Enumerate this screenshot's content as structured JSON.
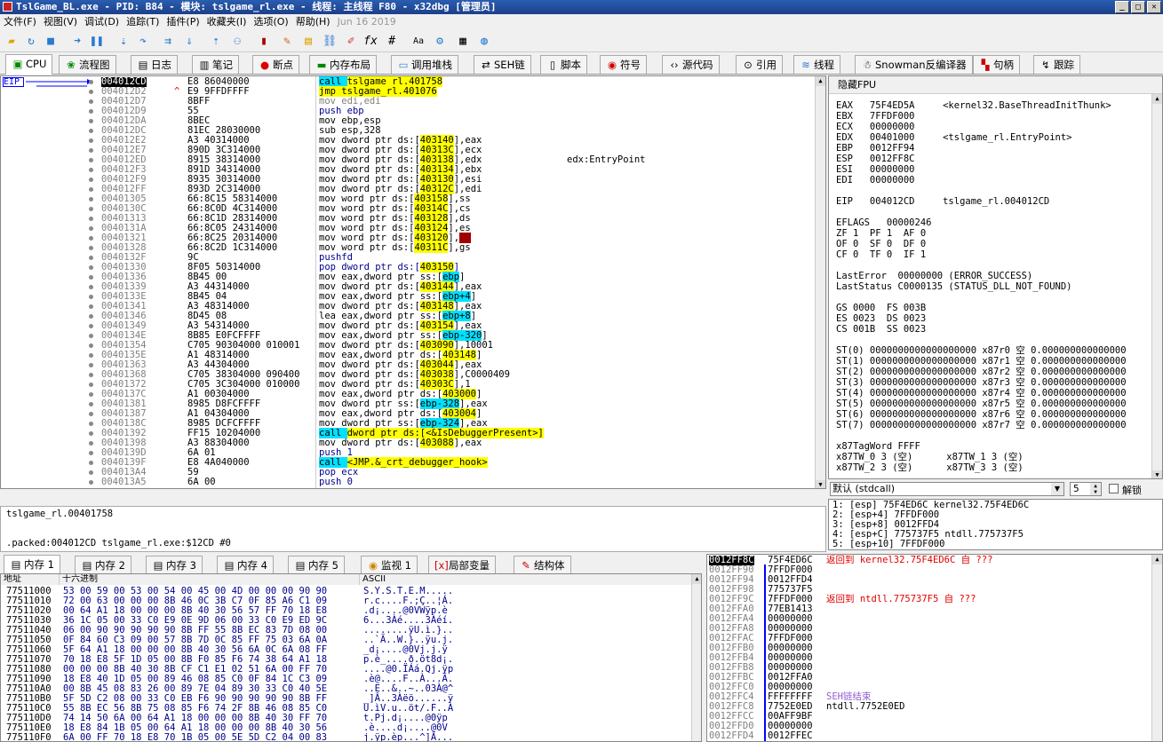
{
  "window": {
    "title": "TslGame_BL.exe - PID: B84 - 模块: tslgame_rl.exe - 线程: 主线程 F80 - x32dbg [管理员]",
    "date": "Jun 16 2019"
  },
  "menu": [
    "文件(F)",
    "视图(V)",
    "调试(D)",
    "追踪(T)",
    "插件(P)",
    "收藏夹(I)",
    "选项(O)",
    "帮助(H)"
  ],
  "tabs": [
    {
      "label": "CPU",
      "icon": "cpu-icon"
    },
    {
      "label": "流程图",
      "icon": "graph-icon"
    },
    {
      "label": "日志",
      "icon": "log-icon"
    },
    {
      "label": "笔记",
      "icon": "notes-icon"
    },
    {
      "label": "断点",
      "icon": "breakpoint-icon"
    },
    {
      "label": "内存布局",
      "icon": "memory-map-icon"
    },
    {
      "label": "调用堆栈",
      "icon": "call-stack-icon"
    },
    {
      "label": "SEH链",
      "icon": "seh-icon"
    },
    {
      "label": "脚本",
      "icon": "script-icon"
    },
    {
      "label": "符号",
      "icon": "symbol-icon"
    },
    {
      "label": "源代码",
      "icon": "source-icon"
    },
    {
      "label": "引用",
      "icon": "reference-icon"
    },
    {
      "label": "线程",
      "icon": "thread-icon"
    },
    {
      "label": "Snowman反编译器",
      "icon": "snowman-icon"
    },
    {
      "label": "句柄",
      "icon": "handle-icon"
    },
    {
      "label": "跟踪",
      "icon": "trace-icon"
    }
  ],
  "eip_label": "EIP",
  "disasm": [
    {
      "a": "004012CD",
      "b": "E8 86040000",
      "d": [
        [
          "c",
          "call "
        ],
        [
          "y",
          "tslgame_rl.401758"
        ]
      ],
      "cm": ""
    },
    {
      "a": "004012D2",
      "b": "E9 9FFDFFFF",
      "d": [
        [
          "y",
          "jmp "
        ],
        [
          "y",
          "tslgame_rl.401076"
        ]
      ],
      "cm": ""
    },
    {
      "a": "004012D7",
      "b": "8BFF",
      "d": [
        [
          "g",
          "mov edi,edi"
        ]
      ],
      "cm": ""
    },
    {
      "a": "004012D9",
      "b": "55",
      "d": [
        [
          "k",
          "push ebp"
        ]
      ],
      "cm": ""
    },
    {
      "a": "004012DA",
      "b": "8BEC",
      "d": [
        [
          "n",
          "mov ebp,esp"
        ]
      ],
      "cm": ""
    },
    {
      "a": "004012DC",
      "b": "81EC 28030000",
      "d": [
        [
          "n",
          "sub esp,328"
        ]
      ],
      "cm": ""
    },
    {
      "a": "004012E2",
      "b": "A3 40314000",
      "d": [
        [
          "n",
          "mov dword ptr ds:["
        ],
        [
          "y",
          "403140"
        ],
        [
          "n",
          "],eax"
        ]
      ],
      "cm": ""
    },
    {
      "a": "004012E7",
      "b": "890D 3C314000",
      "d": [
        [
          "n",
          "mov dword ptr ds:["
        ],
        [
          "y",
          "40313C"
        ],
        [
          "n",
          "],ecx"
        ]
      ],
      "cm": ""
    },
    {
      "a": "004012ED",
      "b": "8915 38314000",
      "d": [
        [
          "n",
          "mov dword ptr ds:["
        ],
        [
          "y",
          "403138"
        ],
        [
          "n",
          "],edx"
        ]
      ],
      "cm": "edx:EntryPoint"
    },
    {
      "a": "004012F3",
      "b": "891D 34314000",
      "d": [
        [
          "n",
          "mov dword ptr ds:["
        ],
        [
          "y",
          "403134"
        ],
        [
          "n",
          "],ebx"
        ]
      ],
      "cm": ""
    },
    {
      "a": "004012F9",
      "b": "8935 30314000",
      "d": [
        [
          "n",
          "mov dword ptr ds:["
        ],
        [
          "y",
          "403130"
        ],
        [
          "n",
          "],esi"
        ]
      ],
      "cm": ""
    },
    {
      "a": "004012FF",
      "b": "893D 2C314000",
      "d": [
        [
          "n",
          "mov dword ptr ds:["
        ],
        [
          "y",
          "40312C"
        ],
        [
          "n",
          "],edi"
        ]
      ],
      "cm": ""
    },
    {
      "a": "00401305",
      "b": "66:8C15 58314000",
      "d": [
        [
          "n",
          "mov word ptr ds:["
        ],
        [
          "y",
          "403158"
        ],
        [
          "n",
          "],ss"
        ]
      ],
      "cm": ""
    },
    {
      "a": "0040130C",
      "b": "66:8C0D 4C314000",
      "d": [
        [
          "n",
          "mov word ptr ds:["
        ],
        [
          "y",
          "40314C"
        ],
        [
          "n",
          "],cs"
        ]
      ],
      "cm": ""
    },
    {
      "a": "00401313",
      "b": "66:8C1D 28314000",
      "d": [
        [
          "n",
          "mov word ptr ds:["
        ],
        [
          "y",
          "403128"
        ],
        [
          "n",
          "],ds"
        ]
      ],
      "cm": ""
    },
    {
      "a": "0040131A",
      "b": "66:8C05 24314000",
      "d": [
        [
          "n",
          "mov word ptr ds:["
        ],
        [
          "y",
          "403124"
        ],
        [
          "n",
          "],es"
        ]
      ],
      "cm": ""
    },
    {
      "a": "00401321",
      "b": "66:8C25 20314000",
      "d": [
        [
          "n",
          "mov word ptr ds:["
        ],
        [
          "y",
          "403120"
        ],
        [
          "n",
          "],"
        ],
        [
          "r",
          "fs"
        ]
      ],
      "cm": ""
    },
    {
      "a": "00401328",
      "b": "66:8C2D 1C314000",
      "d": [
        [
          "n",
          "mov word ptr ds:["
        ],
        [
          "y",
          "40311C"
        ],
        [
          "n",
          "],gs"
        ]
      ],
      "cm": ""
    },
    {
      "a": "0040132F",
      "b": "9C",
      "d": [
        [
          "k",
          "pushfd"
        ]
      ],
      "cm": ""
    },
    {
      "a": "00401330",
      "b": "8F05 50314000",
      "d": [
        [
          "k",
          "pop dword ptr ds:["
        ],
        [
          "y",
          "403150"
        ],
        [
          "k",
          "]"
        ]
      ],
      "cm": ""
    },
    {
      "a": "00401336",
      "b": "8B45 00",
      "d": [
        [
          "n",
          "mov eax,dword ptr ss:["
        ],
        [
          "c",
          "ebp"
        ],
        [
          "n",
          "]"
        ]
      ],
      "cm": ""
    },
    {
      "a": "00401339",
      "b": "A3 44314000",
      "d": [
        [
          "n",
          "mov dword ptr ds:["
        ],
        [
          "y",
          "403144"
        ],
        [
          "n",
          "],eax"
        ]
      ],
      "cm": ""
    },
    {
      "a": "0040133E",
      "b": "8B45 04",
      "d": [
        [
          "n",
          "mov eax,dword ptr ss:["
        ],
        [
          "c",
          "ebp+4"
        ],
        [
          "n",
          "]"
        ]
      ],
      "cm": ""
    },
    {
      "a": "00401341",
      "b": "A3 48314000",
      "d": [
        [
          "n",
          "mov dword ptr ds:["
        ],
        [
          "y",
          "403148"
        ],
        [
          "n",
          "],eax"
        ]
      ],
      "cm": ""
    },
    {
      "a": "00401346",
      "b": "8D45 08",
      "d": [
        [
          "n",
          "lea eax,dword ptr ss:["
        ],
        [
          "c",
          "ebp+8"
        ],
        [
          "n",
          "]"
        ]
      ],
      "cm": ""
    },
    {
      "a": "00401349",
      "b": "A3 54314000",
      "d": [
        [
          "n",
          "mov dword ptr ds:["
        ],
        [
          "y",
          "403154"
        ],
        [
          "n",
          "],eax"
        ]
      ],
      "cm": ""
    },
    {
      "a": "0040134E",
      "b": "8B85 E0FCFFFF",
      "d": [
        [
          "n",
          "mov eax,dword ptr ss:["
        ],
        [
          "c",
          "ebp-320"
        ],
        [
          "n",
          "]"
        ]
      ],
      "cm": ""
    },
    {
      "a": "00401354",
      "b": "C705 90304000 010001",
      "d": [
        [
          "n",
          "mov dword ptr ds:["
        ],
        [
          "y",
          "403090"
        ],
        [
          "n",
          "],10001"
        ]
      ],
      "cm": ""
    },
    {
      "a": "0040135E",
      "b": "A1 48314000",
      "d": [
        [
          "n",
          "mov eax,dword ptr ds:["
        ],
        [
          "y",
          "403148"
        ],
        [
          "n",
          "]"
        ]
      ],
      "cm": ""
    },
    {
      "a": "00401363",
      "b": "A3 44304000",
      "d": [
        [
          "n",
          "mov dword ptr ds:["
        ],
        [
          "y",
          "403044"
        ],
        [
          "n",
          "],eax"
        ]
      ],
      "cm": ""
    },
    {
      "a": "00401368",
      "b": "C705 38304000 090400",
      "d": [
        [
          "n",
          "mov dword ptr ds:["
        ],
        [
          "y",
          "403038"
        ],
        [
          "n",
          "],C0000409"
        ]
      ],
      "cm": ""
    },
    {
      "a": "00401372",
      "b": "C705 3C304000 010000",
      "d": [
        [
          "n",
          "mov dword ptr ds:["
        ],
        [
          "y",
          "40303C"
        ],
        [
          "n",
          "],1"
        ]
      ],
      "cm": ""
    },
    {
      "a": "0040137C",
      "b": "A1 00304000",
      "d": [
        [
          "n",
          "mov eax,dword ptr ds:["
        ],
        [
          "y",
          "403000"
        ],
        [
          "n",
          "]"
        ]
      ],
      "cm": ""
    },
    {
      "a": "00401381",
      "b": "8985 D8FCFFFF",
      "d": [
        [
          "n",
          "mov dword ptr ss:["
        ],
        [
          "c",
          "ebp-328"
        ],
        [
          "n",
          "],eax"
        ]
      ],
      "cm": ""
    },
    {
      "a": "00401387",
      "b": "A1 04304000",
      "d": [
        [
          "n",
          "mov eax,dword ptr ds:["
        ],
        [
          "y",
          "403004"
        ],
        [
          "n",
          "]"
        ]
      ],
      "cm": ""
    },
    {
      "a": "0040138C",
      "b": "8985 DCFCFFFF",
      "d": [
        [
          "n",
          "mov dword ptr ss:["
        ],
        [
          "c",
          "ebp-324"
        ],
        [
          "n",
          "],eax"
        ]
      ],
      "cm": ""
    },
    {
      "a": "00401392",
      "b": "FF15 10204000",
      "d": [
        [
          "c",
          "call "
        ],
        [
          "y",
          "dword ptr ds:[<&IsDebuggerPresent>]"
        ]
      ],
      "cm": ""
    },
    {
      "a": "00401398",
      "b": "A3 88304000",
      "d": [
        [
          "n",
          "mov dword ptr ds:["
        ],
        [
          "y",
          "403088"
        ],
        [
          "n",
          "],eax"
        ]
      ],
      "cm": ""
    },
    {
      "a": "0040139D",
      "b": "6A 01",
      "d": [
        [
          "k",
          "push 1"
        ]
      ],
      "cm": ""
    },
    {
      "a": "0040139F",
      "b": "E8 4A040000",
      "d": [
        [
          "c",
          "call "
        ],
        [
          "y",
          "<JMP.&_crt_debugger_hook>"
        ]
      ],
      "cm": ""
    },
    {
      "a": "004013A4",
      "b": "59",
      "d": [
        [
          "k",
          "pop ecx"
        ]
      ],
      "cm": ""
    },
    {
      "a": "004013A5",
      "b": "6A 00",
      "d": [
        [
          "k",
          "push 0"
        ]
      ],
      "cm": ""
    }
  ],
  "regs_header": "隐藏FPU",
  "regs": [
    "EAX   75F4ED5A     <kernel32.BaseThreadInitThunk>",
    "EBX   7FFDF000",
    "ECX   00000000",
    "EDX   00401000     <tslgame_rl.EntryPoint>",
    "EBP   0012FF94",
    "ESP   0012FF8C",
    "ESI   00000000",
    "EDI   00000000",
    "",
    "EIP   004012CD     tslgame_rl.004012CD",
    "",
    "EFLAGS   00000246",
    "ZF 1  PF 1  AF 0",
    "OF 0  SF 0  DF 0",
    "CF 0  TF 0  IF 1",
    "",
    "LastError  00000000 (ERROR_SUCCESS)",
    "LastStatus C0000135 (STATUS_DLL_NOT_FOUND)",
    "",
    "GS 0000  FS 003B",
    "ES 0023  DS 0023",
    "CS 001B  SS 0023",
    "",
    "ST(0) 0000000000000000000 x87r0 空 0.000000000000000",
    "ST(1) 0000000000000000000 x87r1 空 0.000000000000000",
    "ST(2) 0000000000000000000 x87r2 空 0.000000000000000",
    "ST(3) 0000000000000000000 x87r3 空 0.000000000000000",
    "ST(4) 0000000000000000000 x87r4 空 0.000000000000000",
    "ST(5) 0000000000000000000 x87r5 空 0.000000000000000",
    "ST(6) 0000000000000000000 x87r6 空 0.000000000000000",
    "ST(7) 0000000000000000000 x87r7 空 0.000000000000000",
    "",
    "x87TagWord FFFF",
    "x87TW_0 3 (空)      x87TW_1 3 (空)",
    "x87TW_2 3 (空)      x87TW_3 3 (空)"
  ],
  "callconv": {
    "value": "默认 (stdcall)",
    "argcount": "5",
    "unlock_label": "解锁"
  },
  "stackargs": [
    "1: [esp] 75F4ED6C kernel32.75F4ED6C",
    "2: [esp+4] 7FFDF000",
    "3: [esp+8] 0012FFD4",
    "4: [esp+C] 775737F5 ntdll.775737F5",
    "5: [esp+10] 7FFDF000"
  ],
  "info": {
    "line1": "tslgame_rl.00401758",
    "line2": ".packed:004012CD tslgame_rl.exe:$12CD #0"
  },
  "dumptabs": [
    "内存 1",
    "内存 2",
    "内存 3",
    "内存 4",
    "内存 5",
    "监视 1",
    "局部变量",
    "结构体"
  ],
  "dump_headers": {
    "addr": "地址",
    "hex": "十六进制",
    "ascii": "ASCII"
  },
  "dump": [
    {
      "a": "77511000",
      "h": "53 00 59 00 53 00 54 00 45 00 4D 00 00 00 90 90",
      "s": "S.Y.S.T.E.M....."
    },
    {
      "a": "77511010",
      "h": "72 00 63 00 00 00 8B 46 0C 3B C7 0F 85 A6 C1 09",
      "s": "r.c....F.;Ç..¦Á."
    },
    {
      "a": "77511020",
      "h": "00 64 A1 18 00 00 00 8B 40 30 56 57 FF 70 18 E8",
      "s": ".d¡....@0VWÿp.è"
    },
    {
      "a": "77511030",
      "h": "36 1C 05 00 33 C0 E9 0E 9D 06 00 33 C0 E9 ED 9C",
      "s": "6...3Àé....3Àéí."
    },
    {
      "a": "77511040",
      "h": "06 00 90 90 90 90 90 8B FF 55 8B EC 83 7D 08 00",
      "s": "........ÿU.ì.}.."
    },
    {
      "a": "77511050",
      "h": "0F 84 60 C3 09 00 57 8B 7D 0C 85 FF 75 03 6A 0A",
      "s": "..`Ã..W.}..ÿu.j."
    },
    {
      "a": "77511060",
      "h": "5F 64 A1 18 00 00 00 8B 40 30 56 6A 0C 6A 08 FF",
      "s": "_d¡....@0Vj.j.ÿ"
    },
    {
      "a": "77511070",
      "h": "70 18 E8 5F 1D 05 00 8B F0 85 F6 74 38 64 A1 18",
      "s": "p.è_....ð.öt8d¡."
    },
    {
      "a": "77511080",
      "h": "00 00 00 8B 40 30 8B CF C1 E1 02 51 6A 00 FF 70",
      "s": "....@0.ÏÁá.Qj.ÿp"
    },
    {
      "a": "77511090",
      "h": "18 E8 40 1D 05 00 89 46 08 85 C0 0F 84 1C C3 09",
      "s": ".è@....F..À...Ã."
    },
    {
      "a": "775110A0",
      "h": "00 8B 45 08 83 26 00 89 7E 04 89 30 33 C0 40 5E",
      "s": "..E..&..~..03À@^"
    },
    {
      "a": "775110B0",
      "h": "5F 5D C2 08 00 33 C0 EB F6 90 90 90 90 90 8B FF",
      "s": "_]Â..3Àëö......ÿ"
    },
    {
      "a": "775110C0",
      "h": "55 8B EC 56 8B 75 08 85 F6 74 2F 8B 46 08 85 C0",
      "s": "U.ìV.u..öt/.F..À"
    },
    {
      "a": "775110D0",
      "h": "74 14 50 6A 00 64 A1 18 00 00 00 8B 40 30 FF 70",
      "s": "t.Pj.d¡....@0ÿp"
    },
    {
      "a": "775110E0",
      "h": "18 E8 84 1B 05 00 64 A1 18 00 00 00 8B 40 30 56",
      "s": ".è....d¡....@0V"
    },
    {
      "a": "775110F0",
      "h": "6A 00 FF 70 18 E8 70 1B 05 00 5E 5D C2 04 00 83",
      "s": "j.ÿp.èp...^]Â..."
    }
  ],
  "stack": [
    {
      "a": "0012FF8C",
      "v": "75F4ED6C",
      "c": "返回到 kernel32.75F4ED6C 自 ???",
      "t": "r"
    },
    {
      "a": "0012FF90",
      "v": "7FFDF000",
      "c": "",
      "t": ""
    },
    {
      "a": "0012FF94",
      "v": "0012FFD4",
      "c": "",
      "t": ""
    },
    {
      "a": "0012FF98",
      "v": "775737F5",
      "c": "",
      "t": ""
    },
    {
      "a": "0012FF9C",
      "v": "7FFDF000",
      "c": "返回到 ntdll.775737F5 自 ???",
      "t": "r"
    },
    {
      "a": "0012FFA0",
      "v": "77EB1413",
      "c": "",
      "t": ""
    },
    {
      "a": "0012FFA4",
      "v": "00000000",
      "c": "",
      "t": ""
    },
    {
      "a": "0012FFA8",
      "v": "00000000",
      "c": "",
      "t": ""
    },
    {
      "a": "0012FFAC",
      "v": "7FFDF000",
      "c": "",
      "t": ""
    },
    {
      "a": "0012FFB0",
      "v": "00000000",
      "c": "",
      "t": ""
    },
    {
      "a": "0012FFB4",
      "v": "00000000",
      "c": "",
      "t": ""
    },
    {
      "a": "0012FFB8",
      "v": "00000000",
      "c": "",
      "t": ""
    },
    {
      "a": "0012FFBC",
      "v": "0012FFA0",
      "c": "",
      "t": ""
    },
    {
      "a": "0012FFC0",
      "v": "00000000",
      "c": "",
      "t": ""
    },
    {
      "a": "0012FFC4",
      "v": "FFFFFFFF",
      "c": "SEH链结束",
      "t": "p"
    },
    {
      "a": "0012FFC8",
      "v": "7752E0ED",
      "c": "ntdll.7752E0ED",
      "t": ""
    },
    {
      "a": "0012FFCC",
      "v": "00AFF9BF",
      "c": "",
      "t": ""
    },
    {
      "a": "0012FFD0",
      "v": "00000000",
      "c": "",
      "t": ""
    },
    {
      "a": "0012FFD4",
      "v": "0012FFEC",
      "c": "",
      "t": ""
    }
  ],
  "colors": {
    "title": "#1c3f8a",
    "highlight_yellow": "#ffff00",
    "highlight_cyan": "#00e0ff",
    "eip_blue": "#0000ff",
    "return_red": "#e00000",
    "seh_purple": "#9060d0"
  }
}
